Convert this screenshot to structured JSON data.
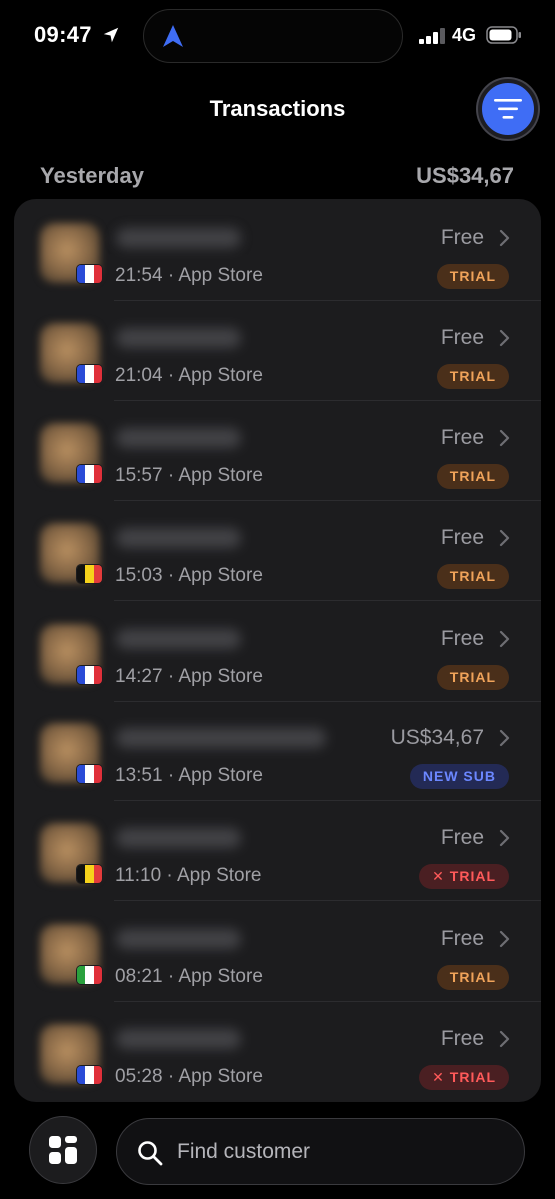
{
  "status_bar": {
    "time": "09:47",
    "network": "4G"
  },
  "header": {
    "title": "Transactions"
  },
  "section": {
    "date_label": "Yesterday",
    "total": "US$34,67"
  },
  "transactions": [
    {
      "time": "21:54",
      "store": "App Store",
      "price": "Free",
      "badge": "TRIAL",
      "badge_type": "trial",
      "flag": "france"
    },
    {
      "time": "21:04",
      "store": "App Store",
      "price": "Free",
      "badge": "TRIAL",
      "badge_type": "trial",
      "flag": "france"
    },
    {
      "time": "15:57",
      "store": "App Store",
      "price": "Free",
      "badge": "TRIAL",
      "badge_type": "trial",
      "flag": "france"
    },
    {
      "time": "15:03",
      "store": "App Store",
      "price": "Free",
      "badge": "TRIAL",
      "badge_type": "trial",
      "flag": "belgium"
    },
    {
      "time": "14:27",
      "store": "App Store",
      "price": "Free",
      "badge": "TRIAL",
      "badge_type": "trial",
      "flag": "france"
    },
    {
      "time": "13:51",
      "store": "App Store",
      "price": "US$34,67",
      "badge": "NEW SUB",
      "badge_type": "new",
      "flag": "france"
    },
    {
      "time": "11:10",
      "store": "App Store",
      "price": "Free",
      "badge": "✕ TRIAL",
      "badge_type": "cancel",
      "flag": "belgium"
    },
    {
      "time": "08:21",
      "store": "App Store",
      "price": "Free",
      "badge": "TRIAL",
      "badge_type": "trial",
      "flag": "italy"
    },
    {
      "time": "05:28",
      "store": "App Store",
      "price": "Free",
      "badge": "✕ TRIAL",
      "badge_type": "cancel",
      "flag": "france"
    }
  ],
  "search": {
    "placeholder": "Find customer"
  },
  "icons": {
    "location": "location-arrow-icon",
    "navigation": "navigation-arrow-icon",
    "filter": "filter-icon",
    "chevron": "chevron-right-icon",
    "apps": "grid-icon",
    "search": "search-icon"
  },
  "colors": {
    "accent": "#3f6df5",
    "trial_text": "#f0a35a",
    "trial_bg": "#4a2f1a",
    "new_sub_text": "#6b87ff",
    "new_sub_bg": "#232a55",
    "cancel_text": "#ff5a5a",
    "cancel_bg": "#4a1f22"
  }
}
